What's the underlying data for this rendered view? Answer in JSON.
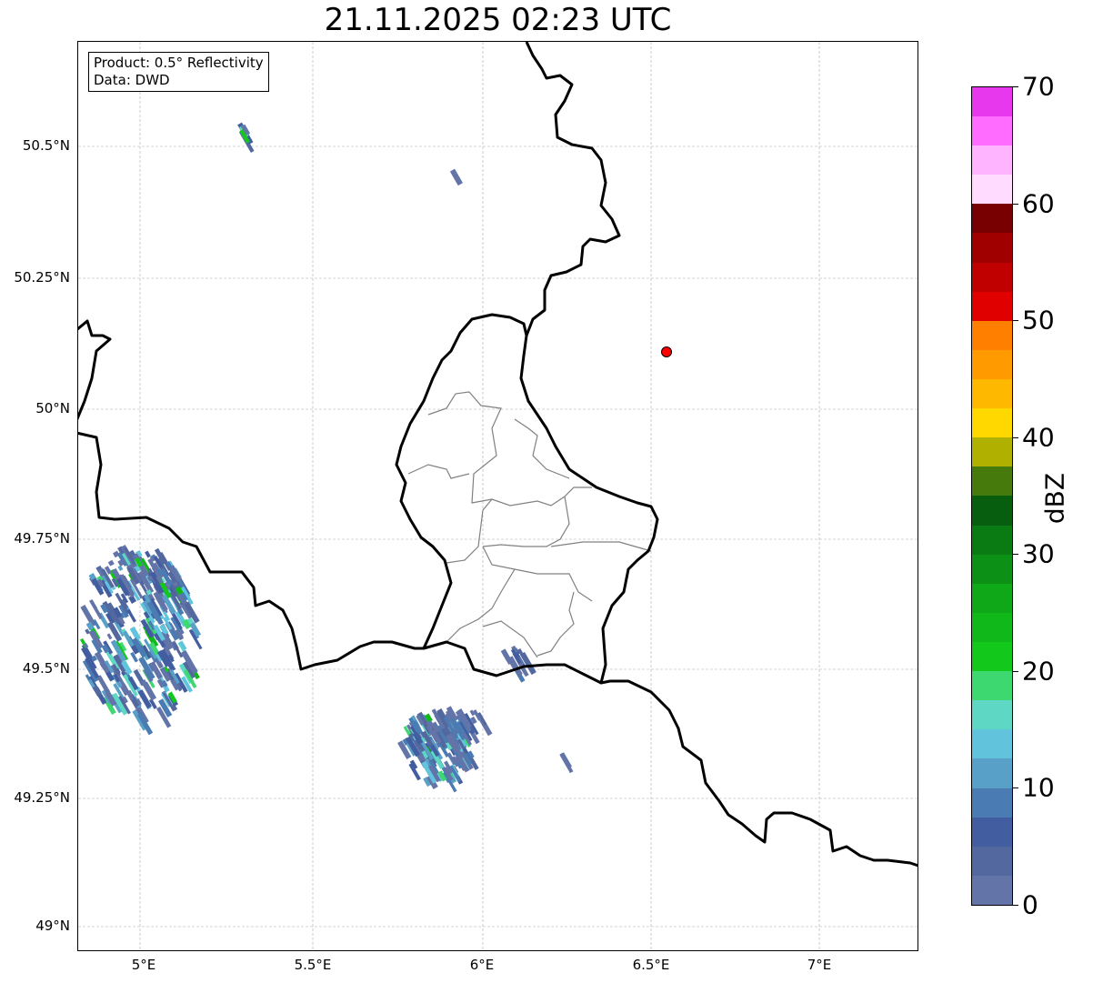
{
  "title": "21.11.2025 02:23 UTC",
  "info_box": {
    "product": "Product: 0.5° Reflectivity",
    "data": "Data: DWD"
  },
  "map": {
    "lat_ticks": [
      "50.5°N",
      "50.25°N",
      "50°N",
      "49.75°N",
      "49.5°N",
      "49.25°N",
      "49°N"
    ],
    "lon_ticks": [
      "5°E",
      "5.5°E",
      "6°E",
      "6.5°E",
      "7°E"
    ],
    "grid": true,
    "marker": {
      "color": "#ff0000",
      "lon": 6.55,
      "lat": 50.11
    }
  },
  "colorbar": {
    "label": "dBZ",
    "ticks": [
      "0",
      "10",
      "20",
      "30",
      "40",
      "50",
      "60",
      "70"
    ],
    "range": [
      0,
      70
    ],
    "step": 2.5,
    "colors": [
      "#6374a8",
      "#53689f",
      "#435ea0",
      "#4a7bb2",
      "#58a0c8",
      "#62c4dc",
      "#5ed8c4",
      "#3ed870",
      "#12c81a",
      "#10b81a",
      "#0ea818",
      "#0c9016",
      "#0a7a12",
      "#065e0e",
      "#467a0c",
      "#b0b000",
      "#ffd800",
      "#ffb800",
      "#ff9a00",
      "#ff7f00",
      "#e00000",
      "#c00000",
      "#a00000",
      "#780000",
      "#ffdcff",
      "#ffb4ff",
      "#ff6cff",
      "#e838ee"
    ]
  }
}
